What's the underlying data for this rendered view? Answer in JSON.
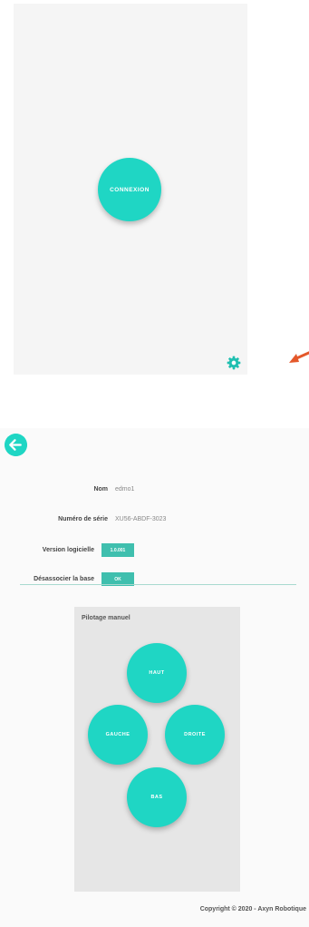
{
  "screen1": {
    "connect_label": "CONNEXION",
    "settings_icon": "gear-icon",
    "annotation_icon": "red-arrow-icon"
  },
  "screen2": {
    "back_icon": "arrow-left-icon",
    "info": {
      "name_label": "Nom",
      "name_value": "edmo1",
      "serial_label": "Numéro de série",
      "serial_value": "XU56-ABDF-3023",
      "version_label": "Version logicielle",
      "version_value": "1.0.001",
      "unlink_label": "Désassocier la base",
      "unlink_button": "OK"
    },
    "pilot": {
      "title": "Pilotage manuel",
      "up": "HAUT",
      "left": "GAUCHE",
      "right": "DROITE",
      "down": "BAS"
    },
    "copyright": "Copyright © 2020 - Axyn Robotique"
  },
  "colors": {
    "accent": "#1fd6c4",
    "button": "#3fbfae",
    "annotation": "#e4582a"
  }
}
